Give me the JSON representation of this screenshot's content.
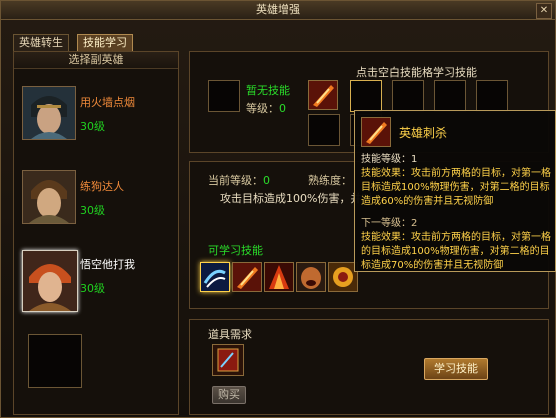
{
  "window": {
    "title": "英雄增强",
    "close_glyph": "✕"
  },
  "tabs": [
    {
      "label": "英雄转生"
    },
    {
      "label": "技能学习"
    }
  ],
  "left": {
    "header": "选择副英雄",
    "heroes": [
      {
        "name": "用火墙点烟",
        "level": "30级"
      },
      {
        "name": "练狗达人",
        "level": "30级"
      },
      {
        "name": "悟空他打我",
        "level": "30级"
      }
    ]
  },
  "skills_top": {
    "hint": "点击空白技能格学习技能",
    "none_title": "暂无技能",
    "level_label": "等级：",
    "level_value": "0"
  },
  "detail": {
    "current_level_label": "当前等级：",
    "current_level_value": "0",
    "proficiency_label": "熟练度：",
    "description": "攻击目标造成100%伤害，并对"
  },
  "learnable": {
    "title": "可学习技能"
  },
  "item": {
    "title": "道具需求",
    "buy_label": "购买",
    "learn_label": "学习技能"
  },
  "tooltip": {
    "name": "英雄刺杀",
    "skill_level_label": "技能等级：",
    "skill_level_value": "1",
    "effect1": "技能效果：攻击前方两格的目标，对第一格目标造成100%物理伤害，对第二格的目标造成60%的伤害并且无视防御",
    "next_level": "下一等级：2",
    "effect2": "技能效果：攻击前方两格的目标，对第一格的目标造成100%物理伤害，对第二格的目标造成70%的伤害并且无视防御"
  },
  "icons": [
    "close-icon",
    "hero-avatar",
    "skill-icon-slash",
    "skill-icon-whirl",
    "skill-book-icon"
  ]
}
